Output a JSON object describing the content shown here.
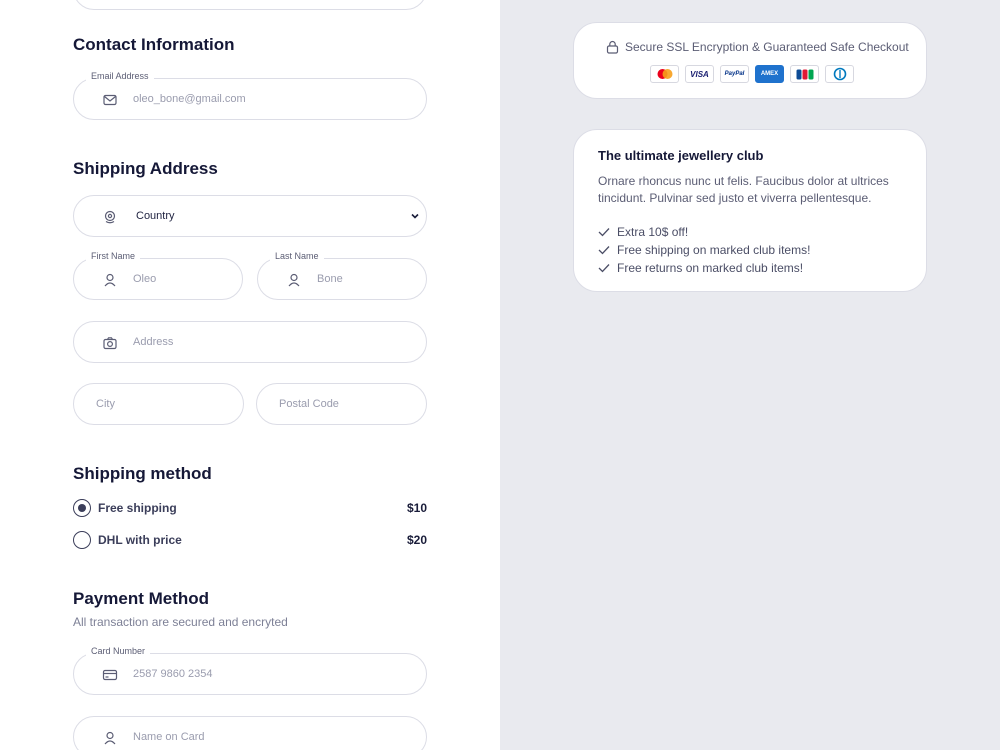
{
  "contact": {
    "title": "Contact Information",
    "email_label": "Email Address",
    "email_placeholder": "oleo_bone@gmail.com"
  },
  "shipping_address": {
    "title": "Shipping Address",
    "country_value": "Country",
    "first_name_label": "First Name",
    "first_name_placeholder": "Oleo",
    "last_name_label": "Last Name",
    "last_name_placeholder": "Bone",
    "address_placeholder": "Address",
    "city_placeholder": "City",
    "postal_placeholder": "Postal Code"
  },
  "shipping_method": {
    "title": "Shipping method",
    "options": [
      {
        "label": "Free shipping",
        "price": "$10",
        "selected": true
      },
      {
        "label": "DHL with price",
        "price": "$20",
        "selected": false
      }
    ]
  },
  "payment": {
    "title": "Payment Method",
    "subtitle": "All transaction are secured and encryted",
    "card_number_label": "Card Number",
    "card_number_placeholder": "2587 9860 2354",
    "name_on_card_placeholder": "Name on Card"
  },
  "secure": {
    "text": "Secure SSL Encryption & Guaranteed Safe Checkout",
    "payment_icons": [
      {
        "name": "mastercard-icon",
        "label": ""
      },
      {
        "name": "visa-icon",
        "label": "VISA"
      },
      {
        "name": "paypal-icon",
        "label": "PayPal"
      },
      {
        "name": "amex-icon",
        "label": "AMEX"
      },
      {
        "name": "jcb-icon",
        "label": "JCB"
      },
      {
        "name": "diners-icon",
        "label": ""
      }
    ]
  },
  "club": {
    "title": "The ultimate jewellery club",
    "description": "Ornare rhoncus nunc ut felis. Faucibus dolor at ultrices tincidunt. Pulvinar sed justo et viverra pellentesque.",
    "perks": [
      "Extra 10$ off!",
      "Free shipping on marked club items!",
      "Free returns on marked club items!"
    ]
  },
  "colors": {
    "right_bg": "#e9eaef",
    "text_dark": "#151837",
    "border": "#dcdde6",
    "amex_blue": "#1f72cd"
  }
}
